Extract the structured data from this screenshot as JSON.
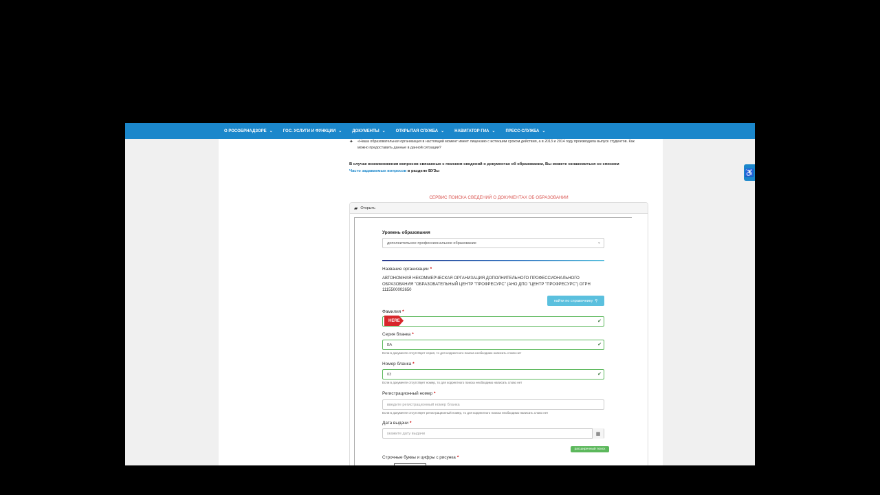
{
  "nav": {
    "items": [
      {
        "label": "О РОСОБРНАДЗОРЕ"
      },
      {
        "label": "ГОС. УСЛУГИ И ФУНКЦИИ"
      },
      {
        "label": "ДОКУМЕНТЫ"
      },
      {
        "label": "ОТКРЫТАЯ СЛУЖБА"
      },
      {
        "label": "НАВИГАТОР ГИА"
      },
      {
        "label": "ПРЕСС-СЛУЖБА"
      }
    ]
  },
  "faq": {
    "question": "«Наша образовательная организация в настоящий момент имеет лицензию с истекшим сроком действия, а в 2013 и 2014 году производила выпуск студентов. Как можно предоставить данные в данной ситуации?"
  },
  "info": {
    "text_before": "В случае возникновения вопросов связанных с поиском сведений о документах об образовании, Вы можете ознакомиться со списком",
    "link": "Часто задаваемых вопросов",
    "text_after": "в разделе ВУЗы"
  },
  "service_title": "СЕРВИС ПОИСКА СВЕДЕНИЙ О ДОКУМЕНТАХ ОБ ОБРАЗОВАНИИ",
  "panel": {
    "toggle_label": "Открыть"
  },
  "form": {
    "level_label": "Уровень образования",
    "level_value": "дополнительное профессиональное образование",
    "org_label": "Название организации",
    "org_value": "АВТОНОМНАЯ НЕКОММЕРЧЕСКАЯ ОРГАНИЗАЦИЯ ДОПОЛНИТЕЛЬНОГО ПРОФЕССИОНАЛЬНОГО ОБРАЗОВАНИЯ \"ОБРАЗОВАТЕЛЬНЫЙ ЦЕНТР \"ПРОФРЕСУРС\" (АНО ДПО \"ЦЕНТР \"ПРОФРЕСУРС\") ОГРН 1115500002650",
    "find_button": "найти по справочнику",
    "surname_label": "Фамилия",
    "surname_value": "",
    "here_tag": "HERE",
    "series_label": "Серия бланка",
    "series_value": "ВА",
    "series_hint": "Если в документе отсутствует серия, то для корректного поиска необходимо написать слово нет",
    "number_label": "Номер бланка",
    "number_value": "03",
    "number_hint": "Если в документе отсутствует номер, то для корректного поиска необходимо написать слово нет",
    "reg_label": "Регистрационный номер",
    "reg_placeholder": "введите регистрационный номер бланка",
    "reg_hint": "Если в документе отсутствует регистрационный номер, то для корректного поиска необходимо написать слово нет",
    "date_label": "Дата выдачи",
    "date_placeholder": "укажите дату выдачи",
    "advanced_button": "расширенный поиск",
    "captcha_label": "Строчные буквы и цифры с рисунка"
  },
  "colors": {
    "nav_bg": "#1b87cb",
    "service_title": "#d9534f",
    "valid_border": "#5cb85c",
    "find_button": "#5bc0de",
    "here_tag": "#d8262b"
  }
}
